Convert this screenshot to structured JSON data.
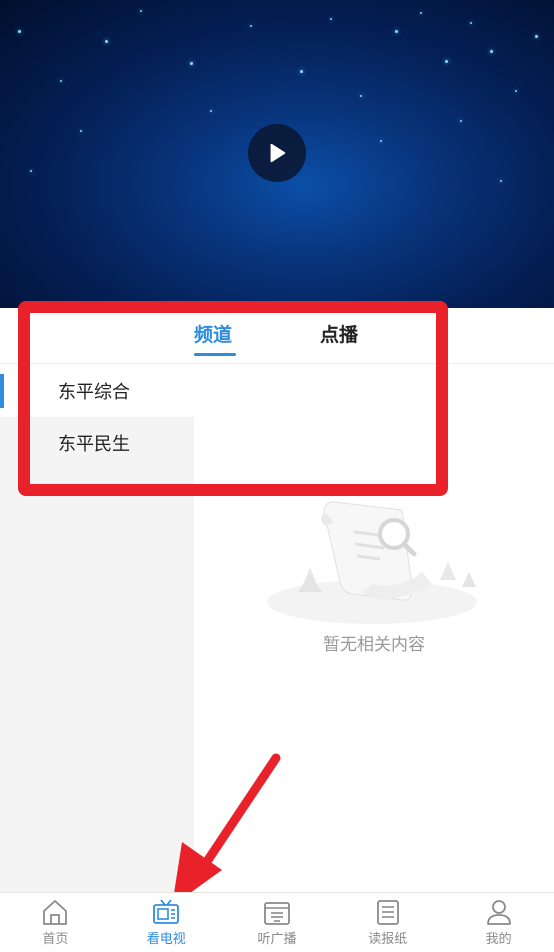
{
  "tabs": [
    {
      "label": "频道",
      "active": true
    },
    {
      "label": "点播",
      "active": false
    }
  ],
  "channels": [
    {
      "label": "东平综合",
      "selected": true
    },
    {
      "label": "东平民生",
      "selected": false
    }
  ],
  "empty_state": {
    "text": "暂无相关内容"
  },
  "bottom_nav": [
    {
      "label": "首页",
      "icon": "home-icon"
    },
    {
      "label": "看电视",
      "icon": "tv-icon",
      "active": true
    },
    {
      "label": "听广播",
      "icon": "radio-icon"
    },
    {
      "label": "读报纸",
      "icon": "newspaper-icon"
    },
    {
      "label": "我的",
      "icon": "user-icon"
    }
  ],
  "colors": {
    "accent": "#2e8de0",
    "annotation": "#e8212b"
  }
}
